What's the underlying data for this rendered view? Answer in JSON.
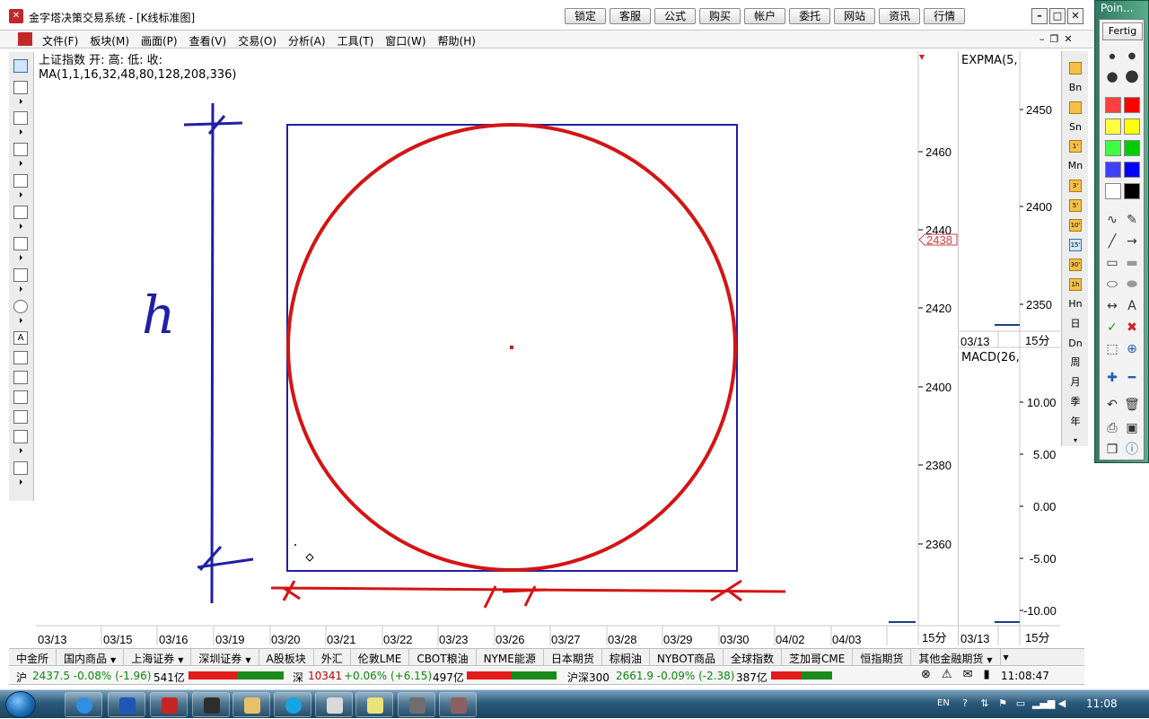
{
  "window": {
    "title": "金字塔决策交易系统 - [K线标准图]",
    "quick_buttons": [
      "锁定",
      "客服",
      "公式",
      "购买",
      "帐户",
      "委托",
      "网站",
      "资讯",
      "行情"
    ]
  },
  "menu": {
    "items": [
      "文件(F)",
      "板块(M)",
      "画面(P)",
      "查看(V)",
      "交易(O)",
      "分析(A)",
      "工具(T)",
      "窗口(W)",
      "帮助(H)"
    ]
  },
  "main_chart": {
    "info_line1": "上证指数 开: 高: 低: 收:",
    "info_line2": "MA(1,1,16,32,48,80,128,208,336)",
    "y_ticks": [
      "2460",
      "2440",
      "2420",
      "2400",
      "2380",
      "2360"
    ],
    "price_marker": "2438",
    "x_ticks": [
      "03/13",
      "03/15",
      "03/16",
      "03/19",
      "03/20",
      "03/21",
      "03/22",
      "03/23",
      "03/26",
      "03/27",
      "03/28",
      "03/29",
      "03/30",
      "04/02",
      "04/03"
    ],
    "period": "15分",
    "annotation_h": "h"
  },
  "expma_panel": {
    "title": "EXPMA(5,",
    "y_ticks": [
      "2450",
      "2400",
      "2350"
    ],
    "date": "03/13",
    "period": "15分"
  },
  "macd_panel": {
    "title": "MACD(26,",
    "y_ticks": [
      "10.00",
      "5.00",
      "0.00",
      "-5.00",
      "-10.00"
    ],
    "date": "03/13",
    "period": "15分"
  },
  "period_toolbar": {
    "items": [
      "Bn",
      "Sn",
      "Mn",
      "Hn",
      "日",
      "Dn",
      "周",
      "月",
      "季",
      "年"
    ],
    "small_icons": [
      "1'",
      "3'",
      "5'",
      "10'",
      "15'",
      "30'",
      "1h"
    ]
  },
  "palette": {
    "title": "Poin...",
    "done_button": "Fertig",
    "colors": [
      "#ff4040",
      "#ff0000",
      "#ffff40",
      "#ffff00",
      "#40ff40",
      "#00cc00",
      "#4040ff",
      "#0000ff",
      "#ffffff",
      "#000000"
    ]
  },
  "market_tabs": [
    {
      "label": "中金所",
      "dropdown": false
    },
    {
      "label": "国内商品",
      "dropdown": true
    },
    {
      "label": "上海证券",
      "dropdown": true
    },
    {
      "label": "深圳证券",
      "dropdown": true
    },
    {
      "label": "A股板块",
      "dropdown": false
    },
    {
      "label": "外汇",
      "dropdown": false
    },
    {
      "label": "伦敦LME",
      "dropdown": false
    },
    {
      "label": "CBOT粮油",
      "dropdown": false
    },
    {
      "label": "NYME能源",
      "dropdown": false
    },
    {
      "label": "日本期货",
      "dropdown": false
    },
    {
      "label": "棕榈油",
      "dropdown": false
    },
    {
      "label": "NYBOT商品",
      "dropdown": false
    },
    {
      "label": "全球指数",
      "dropdown": false
    },
    {
      "label": "芝加哥CME",
      "dropdown": false
    },
    {
      "label": "恒指期货",
      "dropdown": false
    },
    {
      "label": "其他金融期货",
      "dropdown": true
    }
  ],
  "status": {
    "sh_label": "沪",
    "sh_value": "2437.5 -0.08% (-1.96)",
    "sh_volume": "541亿",
    "sz_label": "深",
    "sz_value": "10341",
    "sz_change": "+0.06% (+6.15)",
    "sz_volume": "497亿",
    "hs_label": "沪深300",
    "hs_value": "2661.9 -0.09% (-2.38)",
    "hs_volume": "387亿",
    "time": "11:08:47"
  },
  "taskbar": {
    "lang": "EN",
    "clock": "11:08"
  }
}
